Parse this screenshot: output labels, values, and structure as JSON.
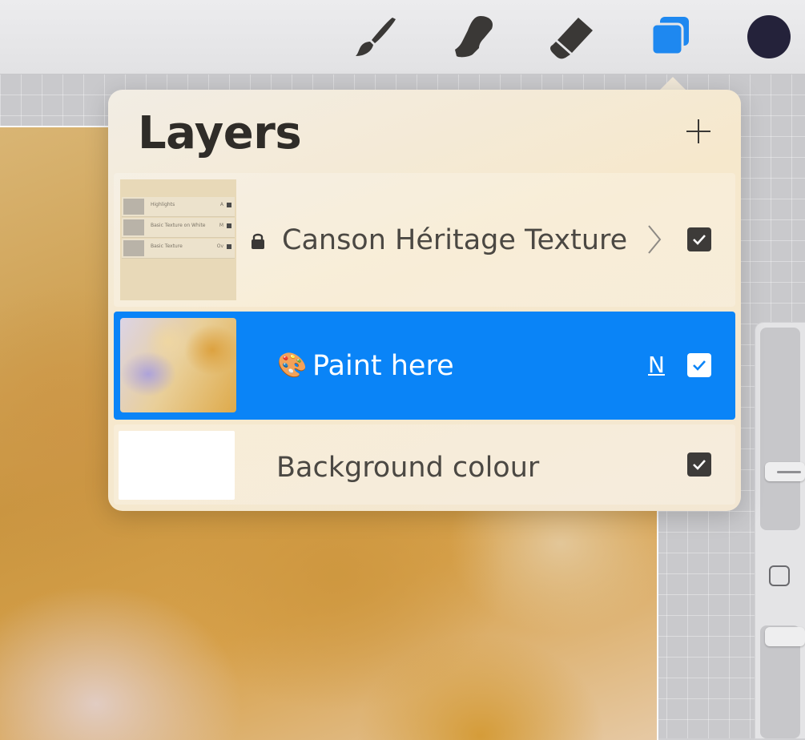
{
  "toolbar": {
    "tools": [
      {
        "name": "paintbrush-icon"
      },
      {
        "name": "smudge-icon"
      },
      {
        "name": "eraser-icon"
      },
      {
        "name": "layers-icon",
        "active": true
      }
    ],
    "active_color": "#24223a",
    "accent": "#1e88f0"
  },
  "layers_panel": {
    "title": "Layers",
    "layers": [
      {
        "name": "Canson Héritage Texture",
        "type": "group",
        "locked": true,
        "visible": true,
        "thumbnail_items": [
          {
            "label": "Highlights",
            "flag": "A"
          },
          {
            "label": "Basic Texture on White",
            "flag": "M"
          },
          {
            "label": "Basic Texture",
            "flag": "Ov"
          }
        ]
      },
      {
        "name": "Paint here",
        "emoji": "🎨",
        "selected": true,
        "blend_mode": "N",
        "visible": true
      },
      {
        "name": "Background colour",
        "visible": true,
        "color": "#ffffff"
      }
    ]
  },
  "sidebar": {
    "brush_size_level": 0.25,
    "opacity_level": 1.0
  }
}
